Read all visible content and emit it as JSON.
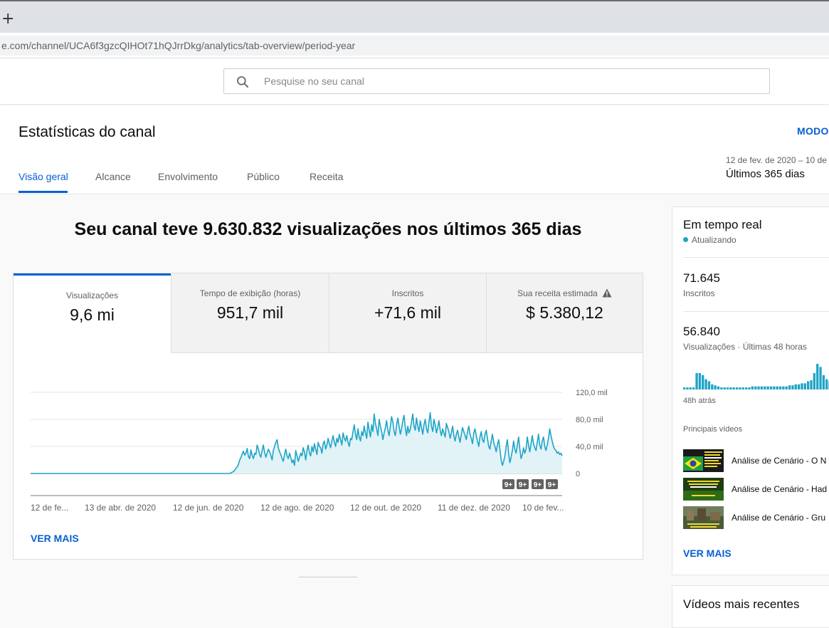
{
  "browser": {
    "new_tab_glyph": "+",
    "url_host": "e.com",
    "url_path": "/channel/UCA6f3gzcQIHOt71hQJrrDkg/analytics/tab-overview/period-year"
  },
  "search": {
    "placeholder": "Pesquise no seu canal",
    "icon": "search-icon"
  },
  "header": {
    "title": "Estatísticas do canal",
    "mode_label": "MODO",
    "date_range": "12 de fev. de 2020 – 10 de",
    "period": "Últimos 365 dias",
    "tabs": [
      {
        "label": "Visão geral",
        "active": true
      },
      {
        "label": "Alcance",
        "active": false
      },
      {
        "label": "Envolvimento",
        "active": false
      },
      {
        "label": "Público",
        "active": false
      },
      {
        "label": "Receita",
        "active": false
      }
    ]
  },
  "main": {
    "headline": "Seu canal teve 9.630.832 visualizações nos últimos 365 dias",
    "metrics": [
      {
        "label": "Visualizações",
        "value": "9,6 mi",
        "selected": true
      },
      {
        "label": "Tempo de exibição (horas)",
        "value": "951,7 mil",
        "selected": false
      },
      {
        "label": "Inscritos",
        "value": "+71,6 mil",
        "selected": false
      },
      {
        "label": "Sua receita estimada",
        "value": "$ 5.380,12",
        "selected": false,
        "icon": "warning-icon"
      }
    ],
    "see_more": "VER MAIS"
  },
  "chart_data": {
    "type": "area",
    "series": [
      {
        "values": [
          0,
          0,
          0,
          0,
          0,
          0,
          0,
          0,
          0,
          0,
          0,
          0,
          0,
          0,
          0,
          0,
          0,
          0,
          0,
          0,
          0,
          0,
          0,
          0,
          0,
          0,
          0,
          0,
          0,
          0,
          0,
          0,
          0,
          0,
          0,
          0,
          0,
          0,
          0,
          0,
          0,
          0,
          0,
          0,
          0,
          0,
          0,
          0,
          0,
          0,
          0,
          0,
          0,
          0,
          0,
          0,
          0,
          0,
          0,
          0,
          0,
          0,
          0,
          0,
          0,
          0,
          0,
          0,
          0,
          0,
          0,
          0,
          0,
          0,
          0,
          0,
          0,
          0,
          0,
          0,
          0,
          0,
          0,
          0,
          0,
          0,
          0,
          0,
          0,
          0,
          0,
          0,
          0,
          0,
          0,
          0,
          0,
          0,
          0,
          0,
          0,
          0,
          0,
          0,
          0,
          0,
          0,
          0,
          0,
          0,
          0,
          0,
          0,
          0,
          0,
          0,
          0,
          0,
          0,
          0,
          0,
          0,
          0,
          0,
          0,
          0,
          0,
          0,
          0,
          0,
          0,
          0,
          0,
          0,
          0,
          0,
          0,
          0,
          0,
          0,
          0,
          0,
          0,
          0,
          0,
          0,
          0,
          0,
          0,
          0,
          0,
          0,
          0,
          0,
          0,
          0,
          0,
          0,
          0,
          0,
          0,
          1,
          2,
          3,
          5,
          8,
          10,
          14,
          20,
          24,
          29,
          33,
          27,
          30,
          37,
          25,
          22,
          35,
          27,
          22,
          30,
          28,
          42,
          36,
          28,
          24,
          34,
          42,
          31,
          24,
          30,
          36,
          32,
          27,
          20,
          34,
          40,
          46,
          50,
          38,
          32,
          28,
          22,
          18,
          28,
          36,
          26,
          22,
          30,
          24,
          16,
          20,
          12,
          34,
          26,
          18,
          24,
          30,
          26,
          38,
          32,
          20,
          34,
          42,
          30,
          26,
          40,
          32,
          44,
          36,
          28,
          46,
          40,
          38,
          30,
          44,
          48,
          36,
          42,
          52,
          44,
          38,
          48,
          56,
          46,
          40,
          52,
          46,
          58,
          50,
          42,
          60,
          52,
          48,
          56,
          46,
          40,
          52,
          50,
          62,
          72,
          58,
          50,
          66,
          54,
          48,
          62,
          56,
          70,
          60,
          52,
          76,
          64,
          54,
          72,
          62,
          88,
          74,
          66,
          56,
          80,
          70,
          62,
          50,
          60,
          68,
          78,
          64,
          56,
          70,
          84,
          76,
          62,
          56,
          72,
          82,
          70,
          58,
          66,
          78,
          86,
          68,
          56,
          70,
          60,
          66,
          76,
          88,
          70,
          64,
          82,
          70,
          62,
          78,
          68,
          58,
          72,
          80,
          66,
          60,
          76,
          90,
          70,
          62,
          80,
          72,
          60,
          68,
          78,
          64,
          56,
          66,
          60,
          54,
          74,
          68,
          62,
          52,
          60,
          70,
          56,
          48,
          58,
          64,
          54,
          46,
          58,
          68,
          62,
          56,
          50,
          62,
          70,
          58,
          52,
          44,
          60,
          66,
          56,
          48,
          40,
          54,
          62,
          50,
          46,
          58,
          64,
          52,
          40,
          36,
          48,
          58,
          46,
          40,
          32,
          42,
          50,
          36,
          20,
          12,
          18,
          26,
          40,
          50,
          30,
          16,
          24,
          34,
          48,
          36,
          30,
          42,
          54,
          36,
          22,
          28,
          38,
          30,
          36,
          54,
          42,
          32,
          44,
          56,
          44,
          38,
          34,
          46,
          58,
          42,
          36,
          48,
          54,
          40,
          34,
          42,
          52,
          66,
          56,
          48,
          40,
          36,
          34,
          30,
          32,
          28,
          30,
          26
        ]
      }
    ],
    "x_tick_labels": [
      "12 de fe...",
      "13 de abr. de 2020",
      "12 de jun. de 2020",
      "12 de ago. de 2020",
      "12 de out. de 2020",
      "11 de dez. de 2020",
      "10 de fev..."
    ],
    "y_tick_labels": [
      "0",
      "40,0 mil",
      "80,0 mil",
      "120,0 mil"
    ],
    "ylim": [
      0,
      120000
    ],
    "y_unit": "mil",
    "line_color": "#1ea4c5",
    "fill_color": "#e2f3f8",
    "badges": [
      "9+",
      "9+",
      "9+",
      "9+"
    ]
  },
  "realtime": {
    "title": "Em tempo real",
    "status": "Atualizando",
    "subscribers_value": "71.645",
    "subscribers_label": "Inscritos",
    "views_value": "56.840",
    "views_label": "Visualizações · Últimas 48 horas",
    "bars": [
      2,
      2,
      2,
      2,
      16,
      16,
      14,
      10,
      8,
      5,
      4,
      3,
      2,
      2,
      2,
      2,
      2,
      2,
      2,
      2,
      2,
      2,
      3,
      3,
      3,
      3,
      3,
      3,
      3,
      3,
      3,
      3,
      3,
      3,
      4,
      4,
      5,
      5,
      6,
      6,
      8,
      9,
      16,
      25,
      22,
      14,
      10,
      8,
      6,
      5
    ],
    "ago_label": "48h atrás",
    "top_videos_label": "Principais vídeos",
    "videos": [
      {
        "title": "Análise de Cenário - O N",
        "thumb": "brazil-flag-thumbnail"
      },
      {
        "title": "Análise de Cenário - Had",
        "thumb": "green-thumbnail"
      },
      {
        "title": "Análise de Cenário - Gru",
        "thumb": "city-thumbnail"
      }
    ],
    "see_more": "VER MAIS"
  },
  "recent": {
    "title": "Vídeos mais recentes"
  }
}
